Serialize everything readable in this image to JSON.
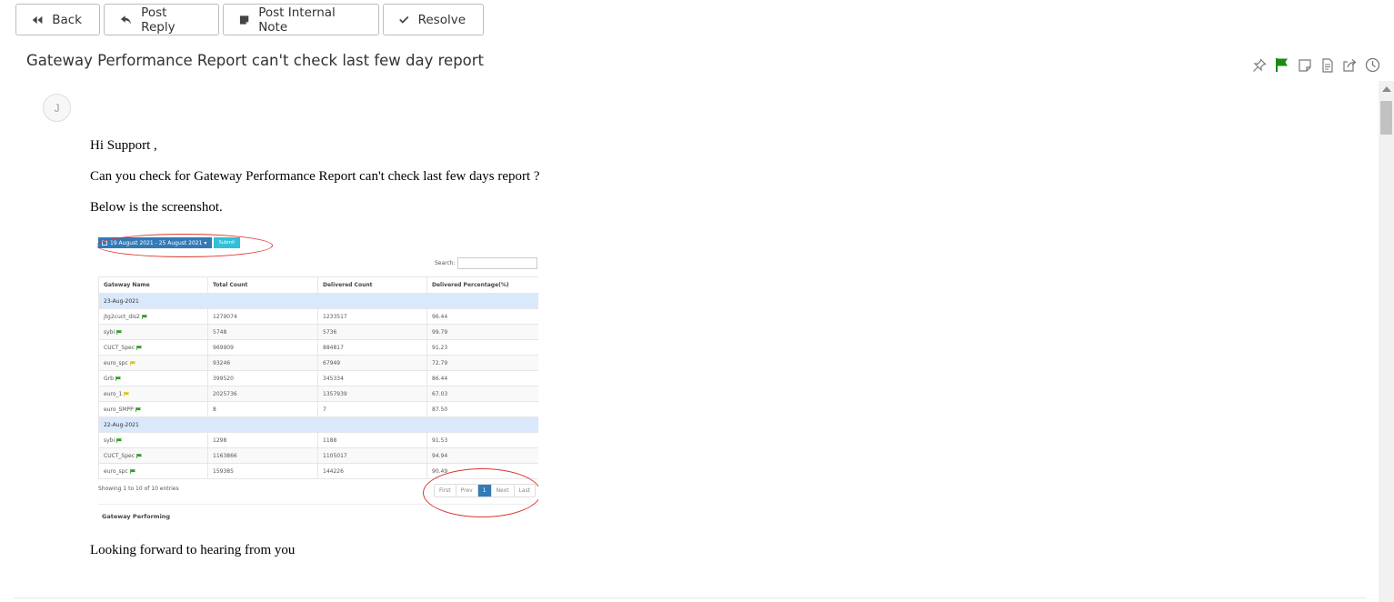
{
  "toolbar": {
    "back": "Back",
    "post_reply": "Post Reply",
    "post_internal_note": "Post Internal Note",
    "resolve": "Resolve"
  },
  "ticket": {
    "title": "Gateway Performance Report can't check last few day report",
    "avatar_initial": "J"
  },
  "message": {
    "greeting": "Hi Support ,",
    "line1": "Can you check for Gateway Performance Report can't check last few days report ?",
    "line2": "Below is the screenshot.",
    "closing": "Looking forward to hearing from you"
  },
  "screenshot": {
    "date_range": "19 August 2021 - 25 August 2021",
    "submit": "Submit",
    "search_label": "Search:",
    "headers": [
      "Gateway Name",
      "Total Count",
      "Delivered Count",
      "Delivered Percentage(%)"
    ],
    "groups": [
      {
        "date": "23-Aug-2021",
        "rows": [
          {
            "name": "jtg2cuct_dis2",
            "flag": "green",
            "total": "1279074",
            "delivered": "1233517",
            "pct": "96.44"
          },
          {
            "name": "sybi",
            "flag": "green",
            "total": "5748",
            "delivered": "5736",
            "pct": "99.79"
          },
          {
            "name": "CUCT_Spec",
            "flag": "green",
            "total": "969909",
            "delivered": "884817",
            "pct": "91.23"
          },
          {
            "name": "euro_spc",
            "flag": "yellow",
            "total": "93246",
            "delivered": "67949",
            "pct": "72.79"
          },
          {
            "name": "Grb",
            "flag": "green",
            "total": "399520",
            "delivered": "345334",
            "pct": "86.44"
          },
          {
            "name": "euro_1",
            "flag": "yellow",
            "total": "2025736",
            "delivered": "1357939",
            "pct": "67.03"
          },
          {
            "name": "euro_SMPP",
            "flag": "green",
            "total": "8",
            "delivered": "7",
            "pct": "87.50"
          }
        ]
      },
      {
        "date": "22-Aug-2021",
        "rows": [
          {
            "name": "sybi",
            "flag": "green",
            "total": "1298",
            "delivered": "1188",
            "pct": "91.53"
          },
          {
            "name": "CUCT_Spec",
            "flag": "green",
            "total": "1163866",
            "delivered": "1105017",
            "pct": "94.94"
          },
          {
            "name": "euro_spc",
            "flag": "green",
            "total": "159385",
            "delivered": "144226",
            "pct": "90.49"
          }
        ]
      }
    ],
    "showing": "Showing 1 to 10 of 10 entries",
    "pager": [
      "First",
      "Prev",
      "1",
      "Next",
      "Last"
    ],
    "footer_heading": "Gateway Performing"
  },
  "colors": {
    "flag_green": "#2e9e22",
    "flag_yellow": "#e0c21a",
    "header_flag": "#1a8a12",
    "annotation_red": "#d9362f"
  },
  "header_icons": [
    "pin-icon",
    "flag-icon",
    "sticky-note-icon",
    "document-icon",
    "share-icon",
    "clock-icon"
  ]
}
